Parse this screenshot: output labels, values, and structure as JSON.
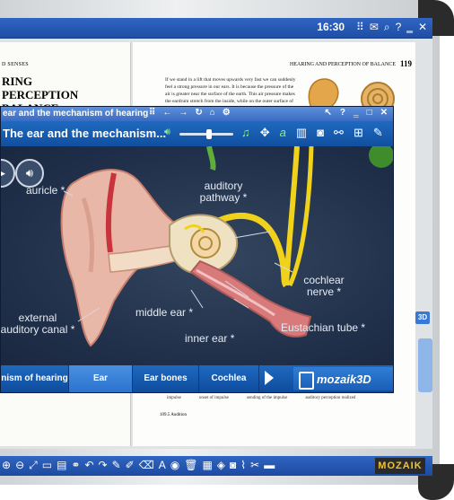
{
  "topbar": {
    "time": "16:30",
    "icons": [
      "grid-icon",
      "mail-icon",
      "search-icon",
      "help-icon",
      "minimize-icon",
      "close-icon"
    ]
  },
  "book": {
    "left_running_head": "D SENSES",
    "left_heading_lines": [
      "RING",
      "PERCEPTION",
      "BALANCE"
    ],
    "right_running_head": "HEARING AND PERCEPTION OF BALANCE",
    "right_page_number": "119",
    "right_paragraph": "If we stand in a lift that moves upwards very fast we can suddenly feel a strong pressure in our ears. It is because the pressure of the air is greater near the surface of the earth. This air pressure makes the eardrum stretch from the inside, while on the outer surface of the eardrum",
    "bottom_captions": [
      "impulse",
      "onset of impulse",
      "sending of the impulse",
      "auditory perception realized"
    ],
    "figure_caption": "109.5 Audition",
    "side_tab": "3D"
  },
  "popup": {
    "window_title": "ear and the mechanism of hearing",
    "toolbar_title": "The ear and the mechanism...",
    "labels": {
      "auricle": "auricle *",
      "auditory_pathway_1": "auditory",
      "auditory_pathway_2": "pathway *",
      "cochlear_nerve_1": "cochlear",
      "cochlear_nerve_2": "nerve *",
      "middle_ear": "middle ear *",
      "inner_ear": "inner ear *",
      "eustachian_tube": "Eustachian tube *",
      "external_canal_1": "external",
      "external_canal_2": "auditory canal *"
    },
    "tabs": [
      "nism of hearing",
      "Ear",
      "Ear bones",
      "Cochlea"
    ],
    "active_tab": "Ear",
    "brand": "mozaik3D"
  },
  "bottombar": {
    "brand": "MOZAIK"
  },
  "colors": {
    "accent_blue": "#1e6ac0",
    "toolbar_blue": "#2f65c2",
    "scene_bg": "#202f49",
    "nerve_yellow": "#f1d21a"
  }
}
